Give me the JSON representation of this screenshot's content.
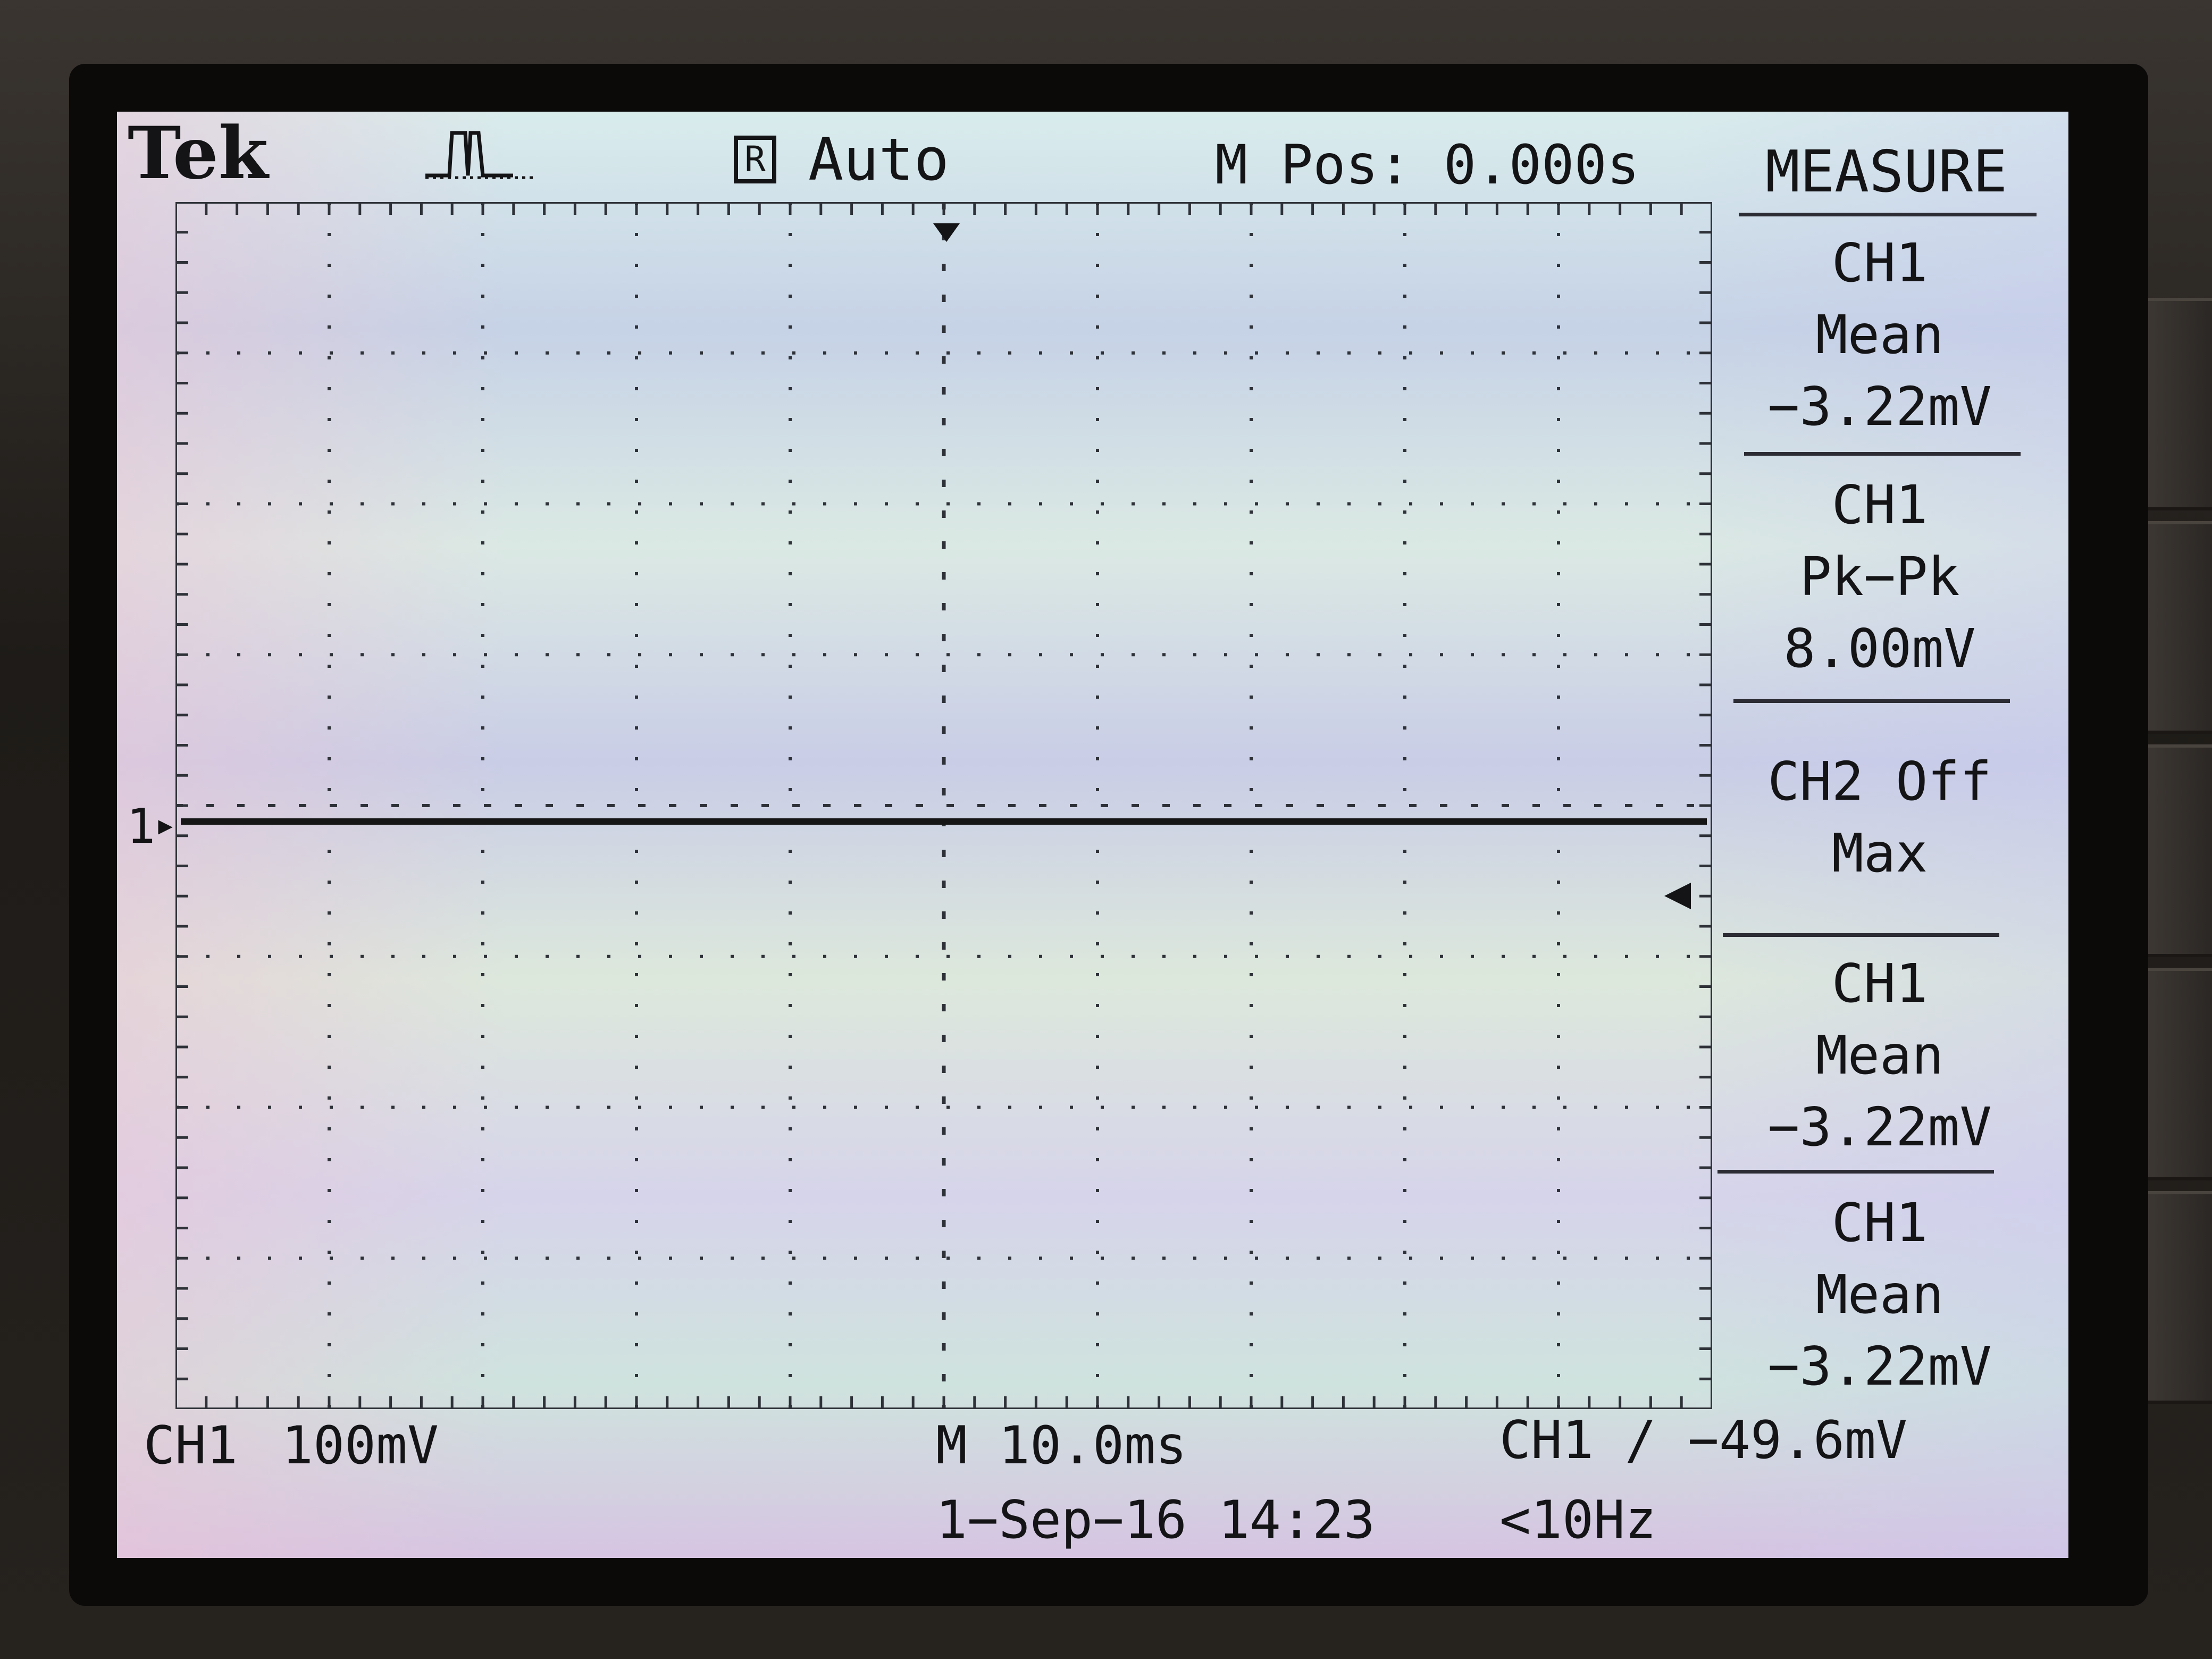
{
  "header": {
    "brand": "Tek",
    "acquire_icon": "waveform-pulse-icon",
    "run_indicator": "R",
    "trigger_status": "Auto",
    "horizontal_position": "M Pos: 0.000s",
    "menu_title": "MEASURE"
  },
  "display": {
    "channel_marker": "1",
    "trace_color": "#161616",
    "graticule_color": "#2e3238"
  },
  "measure_menu": [
    {
      "source": "CH1",
      "type": "Mean",
      "value": "−3.22mV"
    },
    {
      "source": "CH1",
      "type": "Pk−Pk",
      "value": "8.00mV"
    },
    {
      "source": "CH2 Off",
      "type": "Max",
      "value": ""
    },
    {
      "source": "CH1",
      "type": "Mean",
      "value": "−3.22mV"
    },
    {
      "source": "CH1",
      "type": "Mean",
      "value": "−3.22mV"
    }
  ],
  "footer": {
    "ch1_label": "CH1",
    "ch1_scale": "100mV",
    "timebase": "M 10.0ms",
    "trigger_readout": "CH1 ∕ −49.6mV",
    "date_time": "1−Sep−16 14:23",
    "frequency": "<10Hz"
  }
}
